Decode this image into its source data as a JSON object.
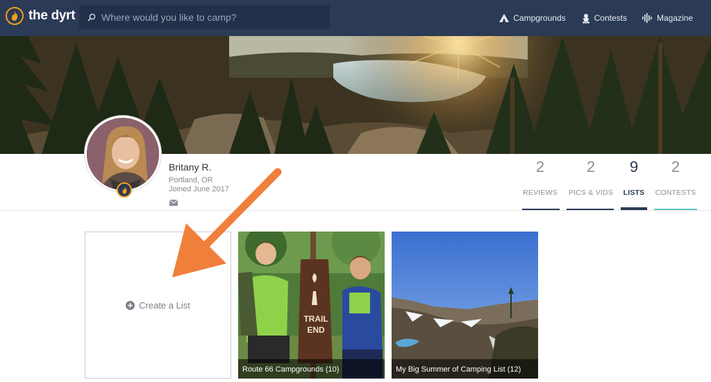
{
  "brand": {
    "name": "the dyrt"
  },
  "search": {
    "placeholder": "Where would you like to camp?"
  },
  "nav": [
    {
      "label": "Campgrounds",
      "icon": "tent-icon"
    },
    {
      "label": "Contests",
      "icon": "trophy-icon"
    },
    {
      "label": "Magazine",
      "icon": "audio-wave-icon"
    }
  ],
  "profile": {
    "name": "Britany R.",
    "location": "Portland, OR",
    "joined": "Joined June 2017"
  },
  "stats": [
    {
      "count": "2",
      "label": "REVIEWS",
      "active": false
    },
    {
      "count": "2",
      "label": "PICS & VIDS",
      "active": false
    },
    {
      "count": "9",
      "label": "LISTS",
      "active": true
    },
    {
      "count": "2",
      "label": "CONTESTS",
      "active": false
    }
  ],
  "lists": {
    "create_label": "Create a List",
    "cards": [
      {
        "title": "Route 66 Campgrounds (10)"
      },
      {
        "title": "My Big Summer of Camping List (12)"
      }
    ]
  },
  "colors": {
    "nav_bg": "#2b3a55",
    "accent_orange": "#f0a11a",
    "arrow": "#f07f3c",
    "active_tab": "#2b3a55",
    "contests_underline": "#5fc6c0"
  },
  "sign_text": {
    "line1": "TRAIL",
    "line2": "END"
  }
}
